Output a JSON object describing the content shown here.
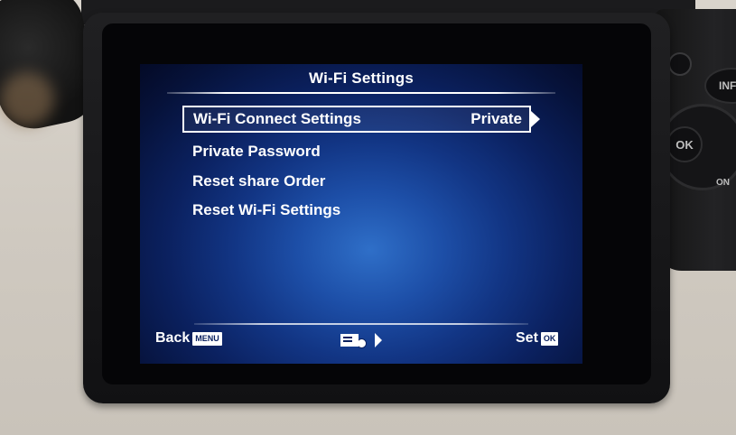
{
  "screen": {
    "title": "Wi-Fi Settings",
    "items": [
      {
        "label": "Wi-Fi Connect Settings",
        "value": "Private",
        "selected": true
      },
      {
        "label": "Private Password"
      },
      {
        "label": "Reset share Order"
      },
      {
        "label": "Reset Wi-Fi Settings"
      }
    ]
  },
  "footer": {
    "back_label": "Back",
    "back_key": "MENU",
    "set_label": "Set",
    "set_key": "OK"
  },
  "camera": {
    "info_label": "INFO",
    "ok_label": "OK",
    "on_label": "ON"
  },
  "icons": {
    "page_icon": "menu-settings-icon",
    "next_icon": "arrow-right-icon"
  },
  "colors": {
    "screen_blue": "#123584",
    "text": "#ffffff"
  }
}
